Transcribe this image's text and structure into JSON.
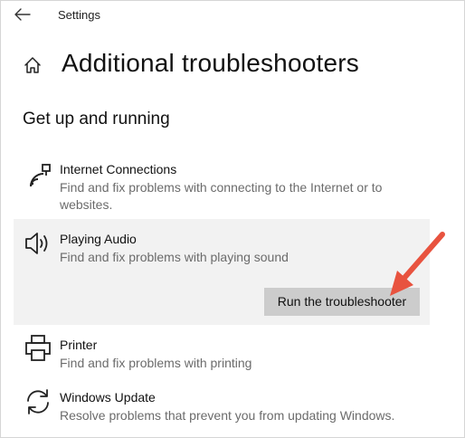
{
  "window": {
    "app_title": "Settings"
  },
  "page": {
    "title": "Additional troubleshooters",
    "section_heading": "Get up and running"
  },
  "troubleshooters": [
    {
      "name": "Internet Connections",
      "description": "Find and fix problems with connecting to the Internet or to websites.",
      "icon": "network-icon"
    },
    {
      "name": "Playing Audio",
      "description": "Find and fix problems with playing sound",
      "icon": "speaker-icon",
      "selected": true,
      "action_label": "Run the troubleshooter"
    },
    {
      "name": "Printer",
      "description": "Find and fix problems with printing",
      "icon": "printer-icon"
    },
    {
      "name": "Windows Update",
      "description": "Resolve problems that prevent you from updating Windows.",
      "icon": "sync-icon"
    }
  ],
  "colors": {
    "selected_background": "#f2f2f2",
    "button_background": "#cccccc",
    "description_text": "#6b6b6b",
    "annotation_arrow": "#e8533f"
  }
}
